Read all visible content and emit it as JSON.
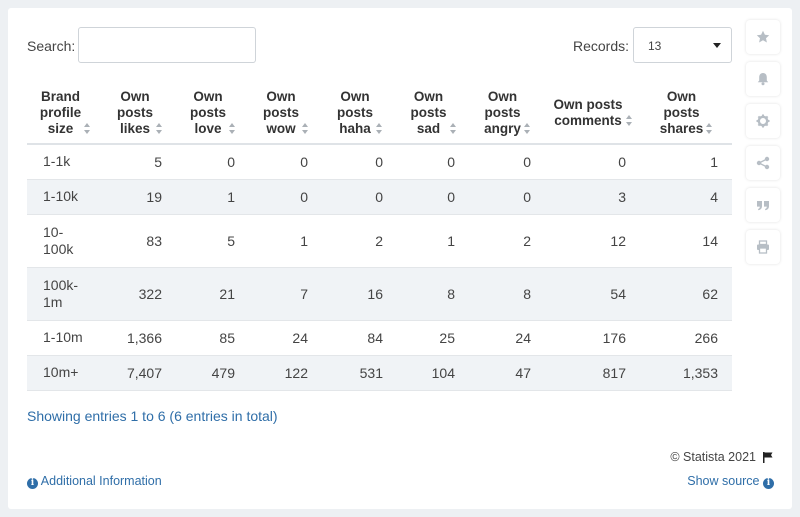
{
  "search": {
    "label": "Search:",
    "value": "",
    "placeholder": ""
  },
  "records": {
    "label": "Records:",
    "selected": "13"
  },
  "table": {
    "headers": [
      [
        "Brand",
        "profile",
        "size"
      ],
      [
        "Own",
        "posts",
        "likes"
      ],
      [
        "Own",
        "posts",
        "love"
      ],
      [
        "Own",
        "posts",
        "wow"
      ],
      [
        "Own",
        "posts",
        "haha"
      ],
      [
        "Own",
        "posts",
        "sad"
      ],
      [
        "Own",
        "posts",
        "angry"
      ],
      [
        "Own posts",
        "comments"
      ],
      [
        "Own",
        "posts",
        "shares"
      ]
    ],
    "rows": [
      [
        "1-1k",
        "5",
        "0",
        "0",
        "0",
        "0",
        "0",
        "0",
        "1"
      ],
      [
        "1-10k",
        "19",
        "1",
        "0",
        "0",
        "0",
        "0",
        "3",
        "4"
      ],
      [
        "10-\n100k",
        "83",
        "5",
        "1",
        "2",
        "1",
        "2",
        "12",
        "14"
      ],
      [
        "100k-\n1m",
        "322",
        "21",
        "7",
        "16",
        "8",
        "8",
        "54",
        "62"
      ],
      [
        "1-10m",
        "1,366",
        "85",
        "24",
        "84",
        "25",
        "24",
        "176",
        "266"
      ],
      [
        "10m+",
        "7,407",
        "479",
        "122",
        "531",
        "104",
        "47",
        "817",
        "1,353"
      ]
    ]
  },
  "footer": {
    "showing": "Showing entries 1 to 6 (6 entries in total)",
    "copyright": "© Statista 2021",
    "additional_info": "Additional Information",
    "show_source": "Show source"
  },
  "sidebar_icons": [
    "star-icon",
    "bell-icon",
    "gear-icon",
    "share-icon",
    "quote-icon",
    "print-icon"
  ],
  "colors": {
    "link": "#2f6ea8",
    "alt_row": "#f0f3f6",
    "icon": "#b7bec5"
  }
}
